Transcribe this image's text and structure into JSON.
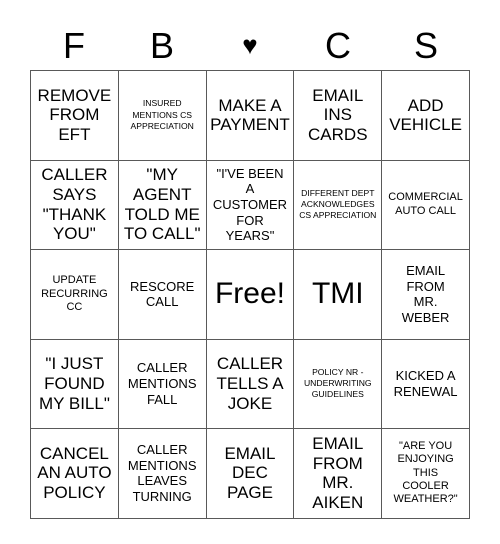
{
  "card": {
    "headers": [
      {
        "label": "F",
        "icon": "letter-f"
      },
      {
        "label": "B",
        "icon": "letter-b"
      },
      {
        "label": "♥",
        "icon": "heart-icon"
      },
      {
        "label": "C",
        "icon": "letter-c"
      },
      {
        "label": "S",
        "icon": "letter-s"
      }
    ],
    "rows": [
      [
        {
          "text": "REMOVE\nFROM\nEFT",
          "size": "lg"
        },
        {
          "text": "INSURED\nMENTIONS CS\nAPPRECIATION",
          "size": "xs"
        },
        {
          "text": "MAKE A\nPAYMENT",
          "size": "lg"
        },
        {
          "text": "EMAIL\nINS\nCARDS",
          "size": "lg"
        },
        {
          "text": "ADD\nVEHICLE",
          "size": "lg"
        }
      ],
      [
        {
          "text": "CALLER\nSAYS\n\"THANK\nYOU\"",
          "size": "lg"
        },
        {
          "text": "\"MY\nAGENT\nTOLD ME\nTO CALL\"",
          "size": "lg"
        },
        {
          "text": "\"I'VE BEEN\nA\nCUSTOMER\nFOR\nYEARS\"",
          "size": "md"
        },
        {
          "text": "DIFFERENT DEPT\nACKNOWLEDGES\nCS APPRECIATION",
          "size": "xs"
        },
        {
          "text": "COMMERCIAL\nAUTO CALL",
          "size": "sm"
        }
      ],
      [
        {
          "text": "UPDATE\nRECURRING\nCC",
          "size": "sm"
        },
        {
          "text": "RESCORE\nCALL",
          "size": "md"
        },
        {
          "text": "Free!",
          "size": "xl"
        },
        {
          "text": "TMI",
          "size": "xl"
        },
        {
          "text": "EMAIL\nFROM\nMR.\nWEBER",
          "size": "md"
        }
      ],
      [
        {
          "text": "\"I JUST\nFOUND\nMY BILL\"",
          "size": "lg"
        },
        {
          "text": "CALLER\nMENTIONS\nFALL",
          "size": "md"
        },
        {
          "text": "CALLER\nTELLS A\nJOKE",
          "size": "lg"
        },
        {
          "text": "POLICY NR -\nUNDERWRITING\nGUIDELINES",
          "size": "xs"
        },
        {
          "text": "KICKED A\nRENEWAL",
          "size": "md"
        }
      ],
      [
        {
          "text": "CANCEL\nAN AUTO\nPOLICY",
          "size": "lg"
        },
        {
          "text": "CALLER\nMENTIONS\nLEAVES\nTURNING",
          "size": "md"
        },
        {
          "text": "EMAIL\nDEC\nPAGE",
          "size": "lg"
        },
        {
          "text": "EMAIL\nFROM\nMR.\nAIKEN",
          "size": "lg"
        },
        {
          "text": "\"ARE YOU\nENJOYING\nTHIS\nCOOLER\nWEATHER?\"",
          "size": "sm"
        }
      ]
    ]
  }
}
